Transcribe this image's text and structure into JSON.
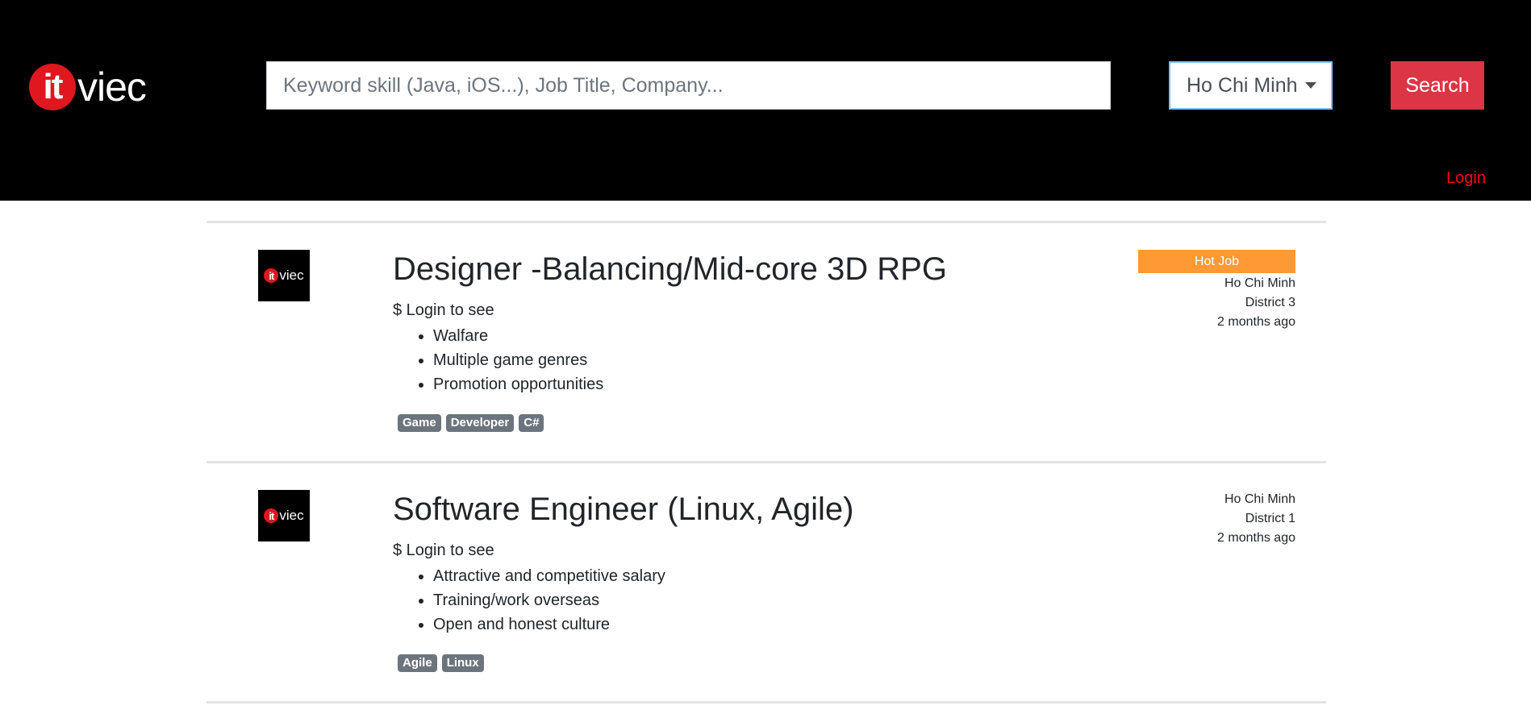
{
  "header": {
    "logo_mark": "it",
    "logo_word": "viec",
    "search_placeholder": "Keyword skill (Java, iOS...), Job Title, Company...",
    "city": "Ho Chi Minh",
    "search_label": "Search",
    "login_label": "Login"
  },
  "colors": {
    "header_bg": "#000000",
    "brand_red": "#e0171f",
    "search_button": "#dc3545",
    "login_link": "#ff0000",
    "hot_badge": "#fd9a33",
    "tag_bg": "#6c757d"
  },
  "jobs": [
    {
      "title": "Designer -Balancing/Mid-core 3D RPG",
      "salary": "$ Login to see",
      "benefits": [
        "Walfare",
        "Multiple game genres",
        "Promotion opportunities"
      ],
      "tags": [
        "Game",
        "Developer",
        "C#"
      ],
      "badge": "Hot Job",
      "city": "Ho Chi Minh",
      "district": "District 3",
      "posted": "2 months ago"
    },
    {
      "title": "Software Engineer (Linux, Agile)",
      "salary": "$ Login to see",
      "benefits": [
        "Attractive and competitive salary",
        "Training/work overseas",
        "Open and honest culture"
      ],
      "tags": [
        "Agile",
        "Linux"
      ],
      "city": "Ho Chi Minh",
      "district": "District 1",
      "posted": "2 months ago"
    }
  ]
}
